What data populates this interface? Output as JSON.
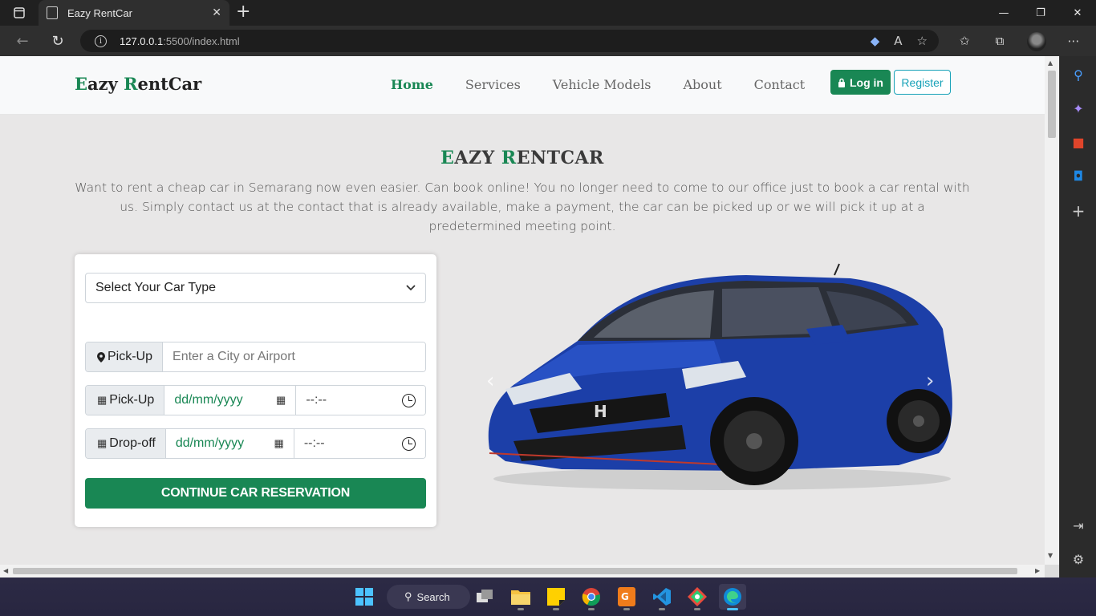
{
  "browser": {
    "tab_title": "Eazy RentCar",
    "url_host": "127.0.0.1",
    "url_path": ":5500/index.html"
  },
  "site": {
    "brand_first_initial": "E",
    "brand_first_rest": "azy ",
    "brand_second_initial": "R",
    "brand_second_rest": "entCar",
    "nav": [
      {
        "label": "Home",
        "active": true
      },
      {
        "label": "Services"
      },
      {
        "label": "Vehicle Models"
      },
      {
        "label": "About"
      },
      {
        "label": "Contact"
      }
    ],
    "login_label": "Log in",
    "register_label": "Register"
  },
  "hero": {
    "title_e": "E",
    "title_mid": "AZY ",
    "title_r": "R",
    "title_rest": "ENTCAR",
    "description": "Want to rent a cheap car in Semarang now even easier. Can book online! You no longer need to come to our office just to book a car rental with us. Simply contact us at the contact that is already available, make a payment, the car can be picked up or we will pick it up at a predetermined meeting point."
  },
  "booking": {
    "car_type_select": "Select Your Car Type",
    "pickup_location_label": "Pick-Up",
    "pickup_location_placeholder": "Enter a City or Airport",
    "pickup_date_label": "Pick-Up",
    "pickup_date_placeholder": "dd/mm/yyyy",
    "pickup_time_placeholder": "--:--",
    "dropoff_label": "Drop-off",
    "dropoff_date_placeholder": "dd/mm/yyyy",
    "dropoff_time_placeholder": "--:--",
    "continue_label": "CONTINUE CAR RESERVATION"
  },
  "taskbar": {
    "search_label": "Search"
  },
  "colors": {
    "brand_green": "#198754",
    "register_teal": "#17a2b8",
    "car_blue": "#1c3fa8"
  }
}
